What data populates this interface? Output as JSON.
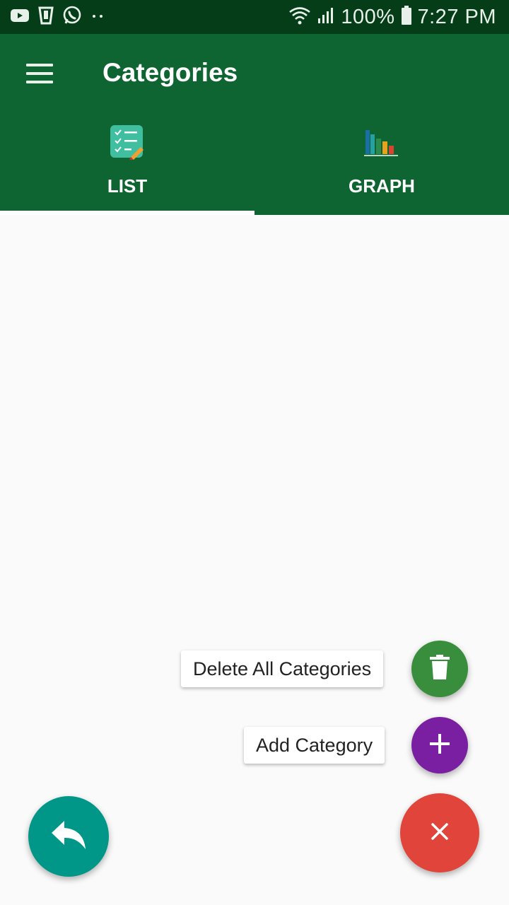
{
  "status_bar": {
    "battery": "100%",
    "time": "7:27 PM",
    "icons": [
      "youtube-icon",
      "clipboard-icon",
      "whatsapp-icon",
      "more-dots-icon",
      "wifi-icon",
      "signal-icon",
      "battery-icon"
    ]
  },
  "app_bar": {
    "title": "Categories",
    "tabs": [
      {
        "label": "LIST",
        "icon": "checklist-icon",
        "selected": true
      },
      {
        "label": "GRAPH",
        "icon": "bar-chart-icon",
        "selected": false
      }
    ]
  },
  "fab_menu": {
    "delete_all_label": "Delete All Categories",
    "add_label": "Add Category"
  },
  "colors": {
    "status_bar": "#053d18",
    "app_bar": "#0e6531",
    "delete_fab": "#388e3c",
    "add_fab": "#7b1fa2",
    "close_fab": "#e0443a",
    "back_fab": "#009688"
  }
}
